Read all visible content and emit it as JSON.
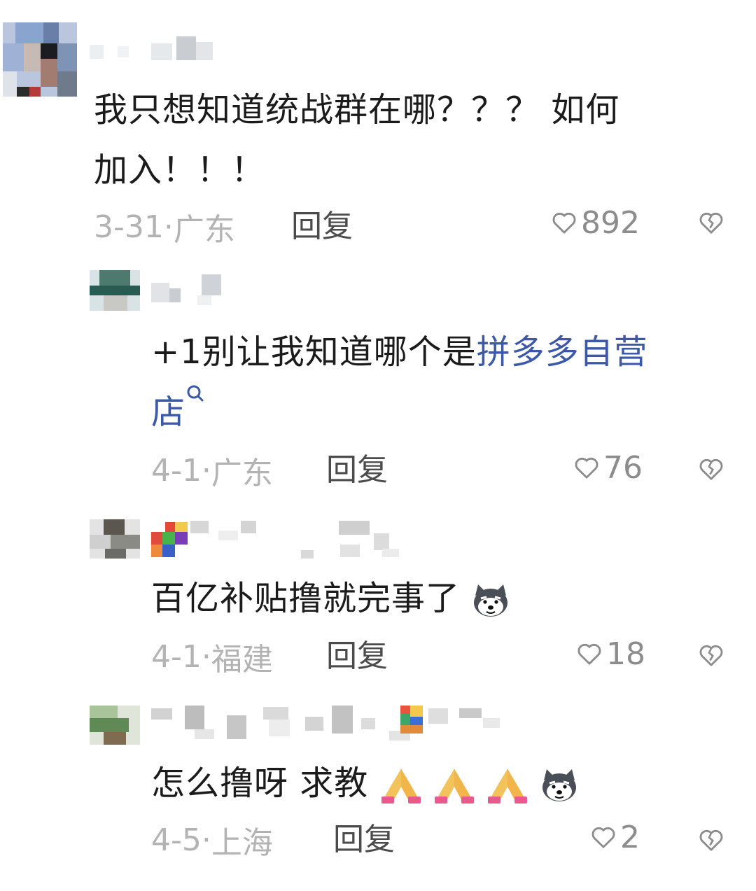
{
  "comments": [
    {
      "text_line1": "我只想知道统战群在哪？？？ 如何",
      "text_line2": "加入！！！",
      "date": "3-31",
      "location": "广东",
      "reply_label": "回复",
      "likes": "892"
    },
    {
      "prefix": "+1别让我知道哪个是",
      "link": "拼多多自营",
      "link_line2": "店",
      "date": "4-1",
      "location": "广东",
      "reply_label": "回复",
      "likes": "76"
    },
    {
      "text": "百亿补贴撸就完事了",
      "date": "4-1",
      "location": "福建",
      "reply_label": "回复",
      "likes": "18"
    },
    {
      "text": "怎么撸呀 求教",
      "date": "4-5",
      "location": "上海",
      "reply_label": "回复",
      "likes": "2"
    }
  ],
  "colors": {
    "link": "#3b59a8",
    "meta": "#b3b3b3",
    "reply": "#4b4b4b",
    "heart": "#8c8c8c"
  },
  "icons": [
    "heart-outline-icon",
    "broken-heart-icon",
    "search-icon",
    "husky-emoji",
    "praying-hands-emoji"
  ]
}
